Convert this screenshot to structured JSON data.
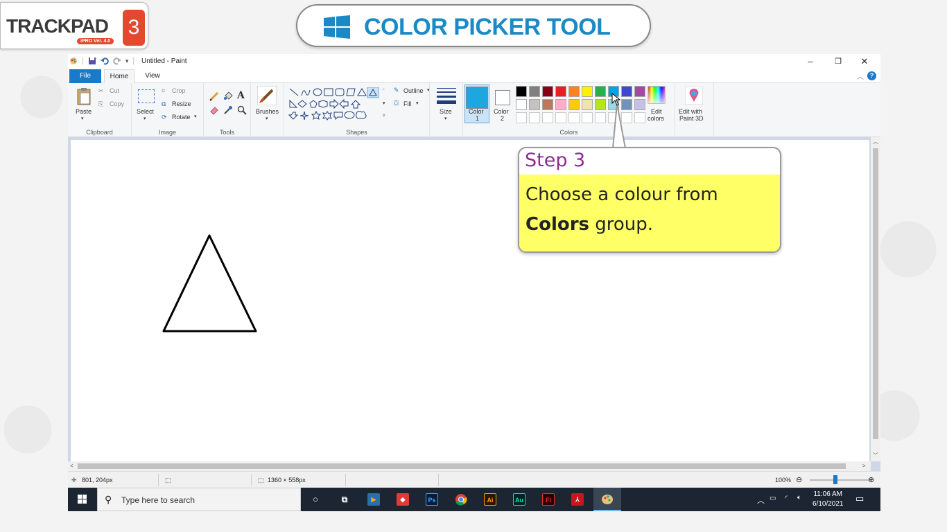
{
  "logo": {
    "text": "TRACKPAD",
    "version": "iPRO Ver. 4.0",
    "number": "3"
  },
  "banner": {
    "title": "COLOR PICKER TOOL"
  },
  "window": {
    "title": "Untitled - Paint",
    "controls": {
      "minimize": "–",
      "restore": "❐",
      "close": "✕"
    }
  },
  "tabs": {
    "file": "File",
    "home": "Home",
    "view": "View"
  },
  "ribbon": {
    "clipboard": {
      "label": "Clipboard",
      "paste": "Paste",
      "cut": "Cut",
      "copy": "Copy"
    },
    "image": {
      "label": "Image",
      "select": "Select",
      "crop": "Crop",
      "resize": "Resize",
      "rotate": "Rotate"
    },
    "tools": {
      "label": "Tools"
    },
    "brushes": {
      "label": "Brushes"
    },
    "shapes": {
      "label": "Shapes",
      "outline": "Outline",
      "fill": "Fill"
    },
    "size": {
      "label": "Size"
    },
    "colors": {
      "label": "Colors",
      "color1_line1": "Color",
      "color1_line2": "1",
      "color2_line1": "Color",
      "color2_line2": "2",
      "color1_value": "#1ca7e0",
      "color2_value": "#ffffff",
      "row1": [
        "#000000",
        "#7f7f7f",
        "#880015",
        "#ed1c24",
        "#ff7f27",
        "#fff200",
        "#22b14c",
        "#00a2e8",
        "#3f48cc",
        "#a349a4"
      ],
      "row2": [
        "#ffffff",
        "#c3c3c3",
        "#b97a57",
        "#ffaec9",
        "#ffc90e",
        "#efe4b0",
        "#b5e61d",
        "#99d9ea",
        "#7092be",
        "#c8bfe7"
      ],
      "edit_colors_line1": "Edit",
      "edit_colors_line2": "colors"
    },
    "paint3d": {
      "line1": "Edit with",
      "line2": "Paint 3D"
    }
  },
  "statusbar": {
    "cursor_position": "801, 204px",
    "canvas_size": "1360 × 558px",
    "zoom": "100%"
  },
  "taskbar": {
    "search_placeholder": "Type here to search",
    "apps": [
      "Ps",
      "Ai",
      "Au",
      "Fl"
    ],
    "time": "11:06 AM",
    "date": "6/10/2021"
  },
  "callout": {
    "step": "Step 3",
    "text_line1": "Choose a colour from",
    "text_bold": "Colors",
    "text_rest": " group."
  }
}
